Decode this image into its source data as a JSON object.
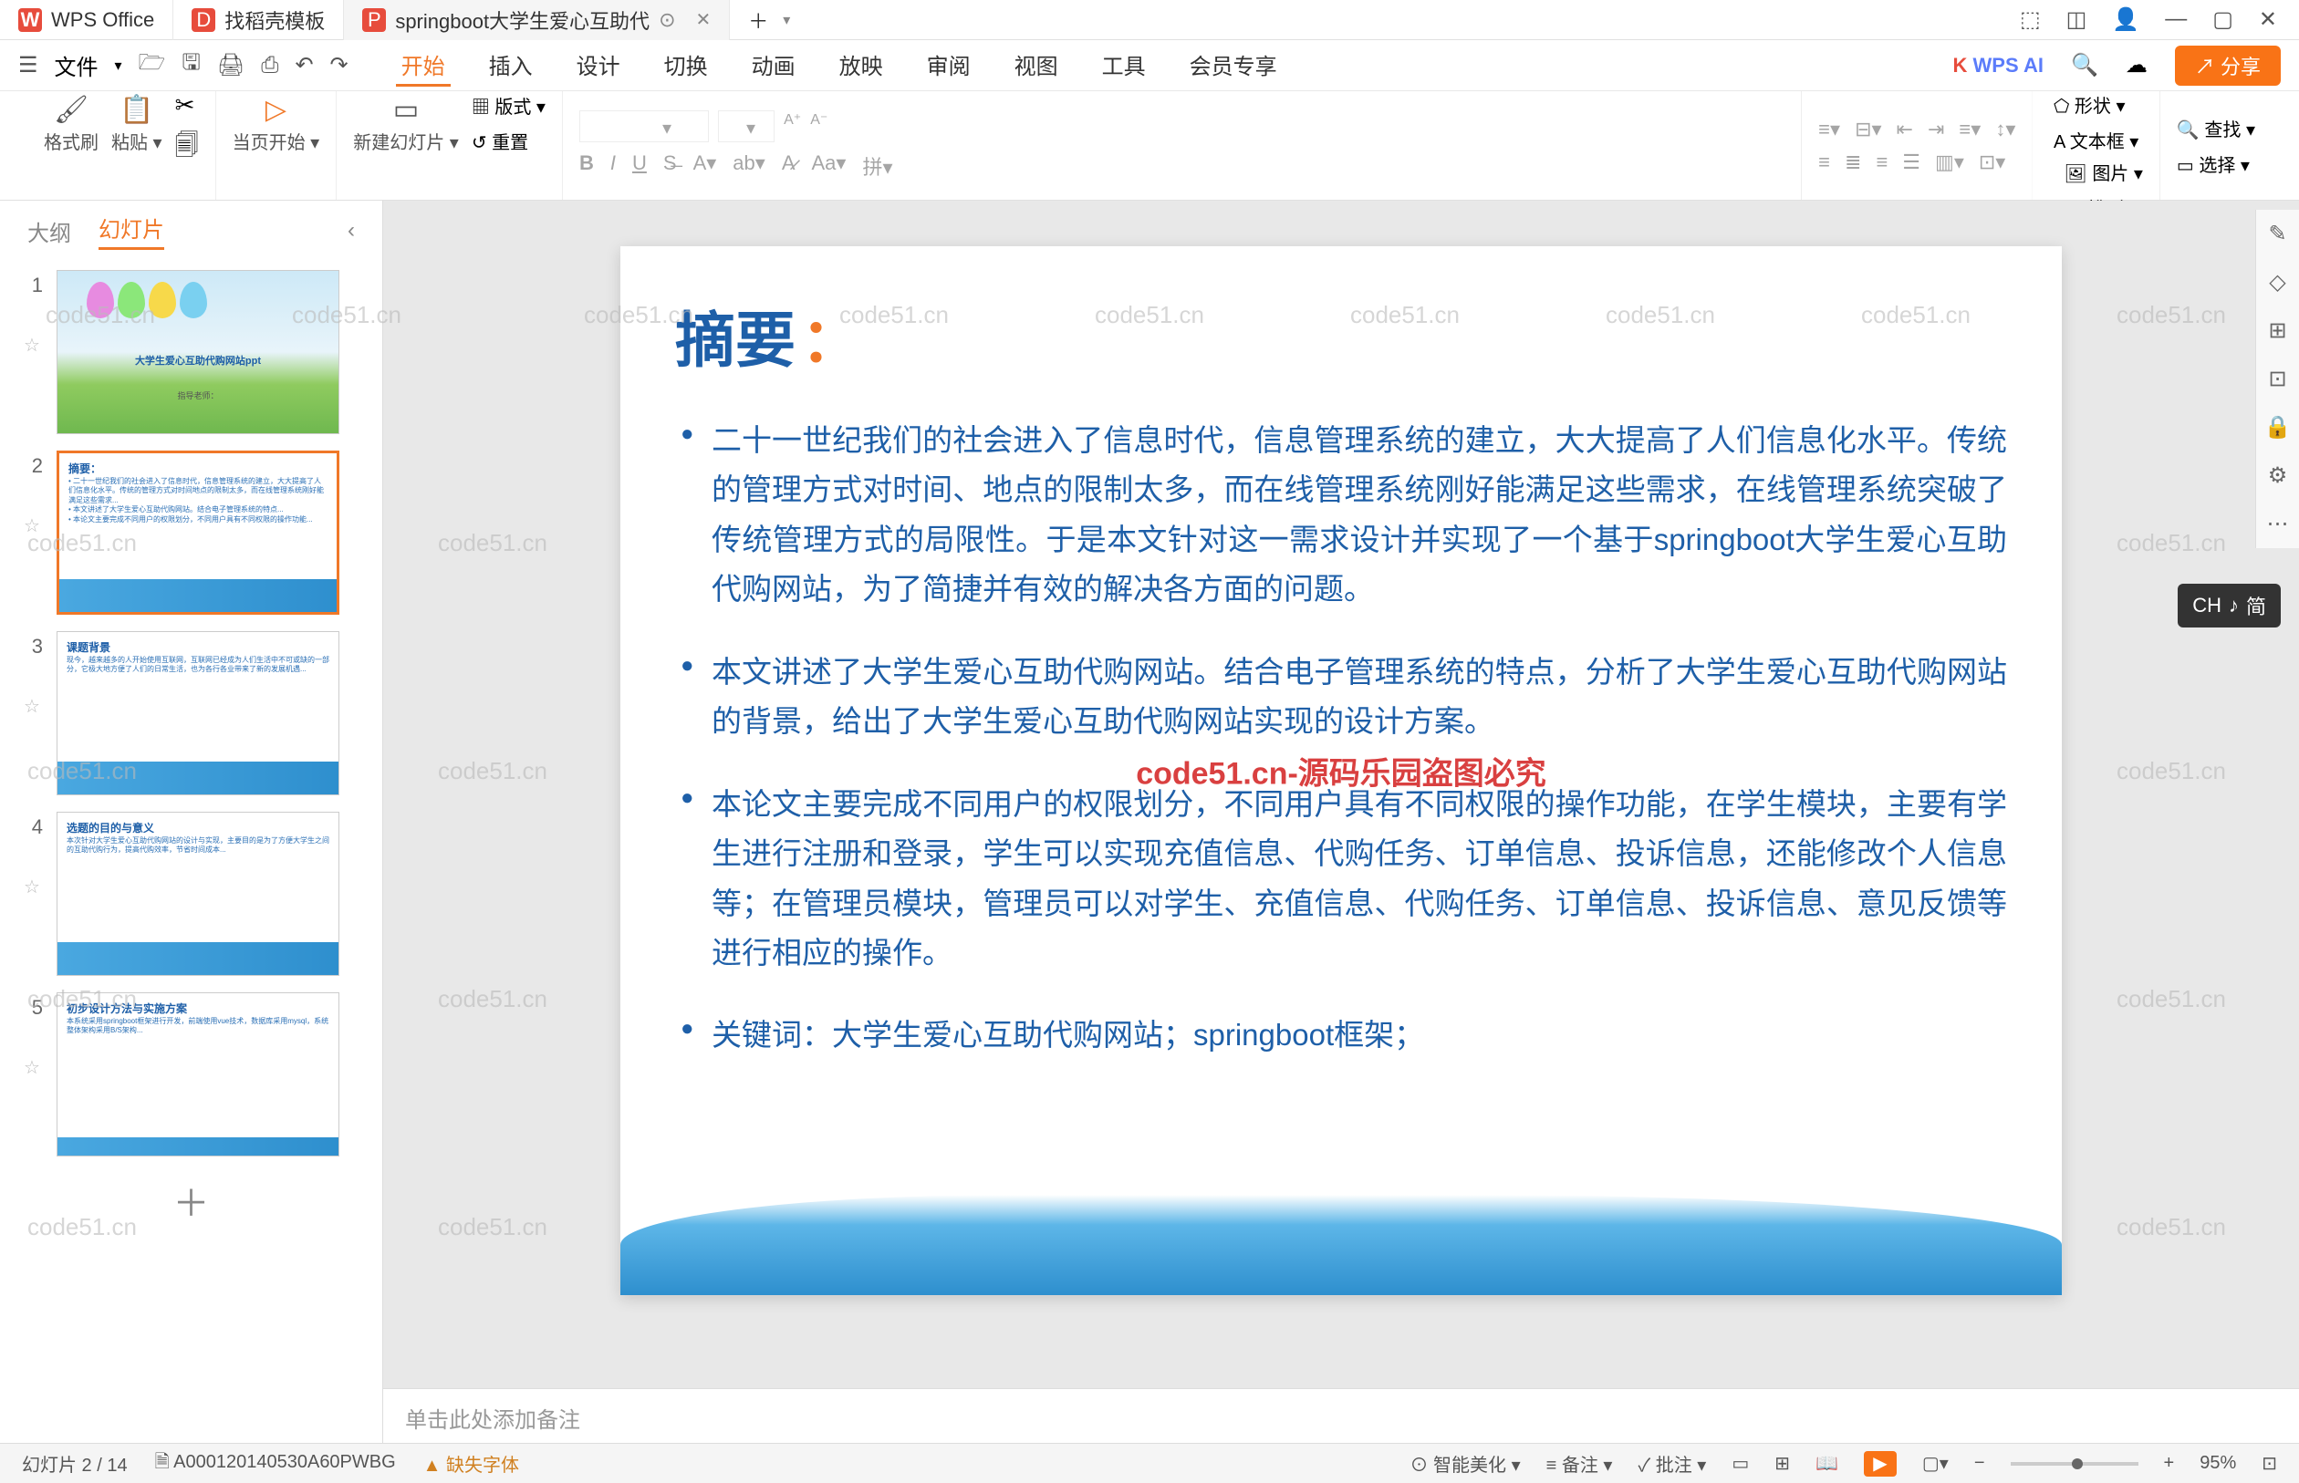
{
  "titlebar": {
    "tabs": [
      {
        "label": "WPS Office",
        "icon": "W"
      },
      {
        "label": "找稻壳模板",
        "icon": "D"
      },
      {
        "label": "springboot大学生爱心互助代",
        "icon": "P",
        "active": true
      }
    ],
    "new_tab": "＋"
  },
  "window_controls": {
    "cube": "⬚",
    "box": "◫",
    "avatar": "👤",
    "min": "—",
    "max": "▢",
    "close": "✕"
  },
  "menubar": {
    "hamburger": "☰",
    "file": "文件",
    "icons": [
      "↶",
      "↷",
      "🖨",
      "⎙",
      "⤴"
    ],
    "tabs": [
      "开始",
      "插入",
      "设计",
      "切换",
      "动画",
      "放映",
      "审阅",
      "视图",
      "工具",
      "会员专享"
    ],
    "active": "开始",
    "wps_ai": "WPS AI",
    "search": "🔍",
    "cloud": "☁",
    "share": "分享"
  },
  "ribbon": {
    "format_brush": "格式刷",
    "paste": "粘贴",
    "from_current": "当页开始",
    "new_slide": "新建幻灯片",
    "layout": "版式",
    "reset": "重置",
    "shape": "形状",
    "picture": "图片",
    "textbox": "文本框",
    "arrange": "排列",
    "find": "查找",
    "select": "选择"
  },
  "sidebar": {
    "tab_outline": "大纲",
    "tab_slides": "幻灯片",
    "thumbs": [
      {
        "num": "1",
        "title": "大学生爱心互助代购网站ppt",
        "sub": "指导老师："
      },
      {
        "num": "2",
        "title": "摘要：",
        "active": true
      },
      {
        "num": "3",
        "title": "课题背景"
      },
      {
        "num": "4",
        "title": "选题的目的与意义"
      },
      {
        "num": "5",
        "title": "初步设计方法与实施方案"
      }
    ]
  },
  "slide": {
    "title": "摘要",
    "colon": "：",
    "bullets": [
      "二十一世纪我们的社会进入了信息时代，信息管理系统的建立，大大提高了人们信息化水平。传统的管理方式对时间、地点的限制太多，而在线管理系统刚好能满足这些需求，在线管理系统突破了传统管理方式的局限性。于是本文针对这一需求设计并实现了一个基于springboot大学生爱心互助代购网站，为了简捷并有效的解决各方面的问题。",
      "本文讲述了大学生爱心互助代购网站。结合电子管理系统的特点，分析了大学生爱心互助代购网站的背景，给出了大学生爱心互助代购网站实现的设计方案。",
      "本论文主要完成不同用户的权限划分，不同用户具有不同权限的操作功能，在学生模块，主要有学生进行注册和登录，学生可以实现充值信息、代购任务、订单信息、投诉信息，还能修改个人信息等；在管理员模块，管理员可以对学生、充值信息、代购任务、订单信息、投诉信息、意见反馈等进行相应的操作。",
      "关键词：大学生爱心互助代购网站；springboot框架；"
    ]
  },
  "watermark": {
    "text": "code51.cn",
    "center": "code51.cn-源码乐园盗图必究"
  },
  "notes": {
    "placeholder": "单击此处添加备注"
  },
  "statusbar": {
    "slide_counter": "幻灯片 2 / 14",
    "doc_id": "A000120140530A60PWBG",
    "missing_font": "缺失字体",
    "beautify": "智能美化",
    "notes": "备注",
    "approve": "批注",
    "zoom": "95%"
  },
  "ime": {
    "label": "CH",
    "mode": "简"
  },
  "side_toolbar": [
    "✎",
    "◇",
    "⊞",
    "⊡",
    "🔒",
    "⚙",
    "⋯"
  ]
}
